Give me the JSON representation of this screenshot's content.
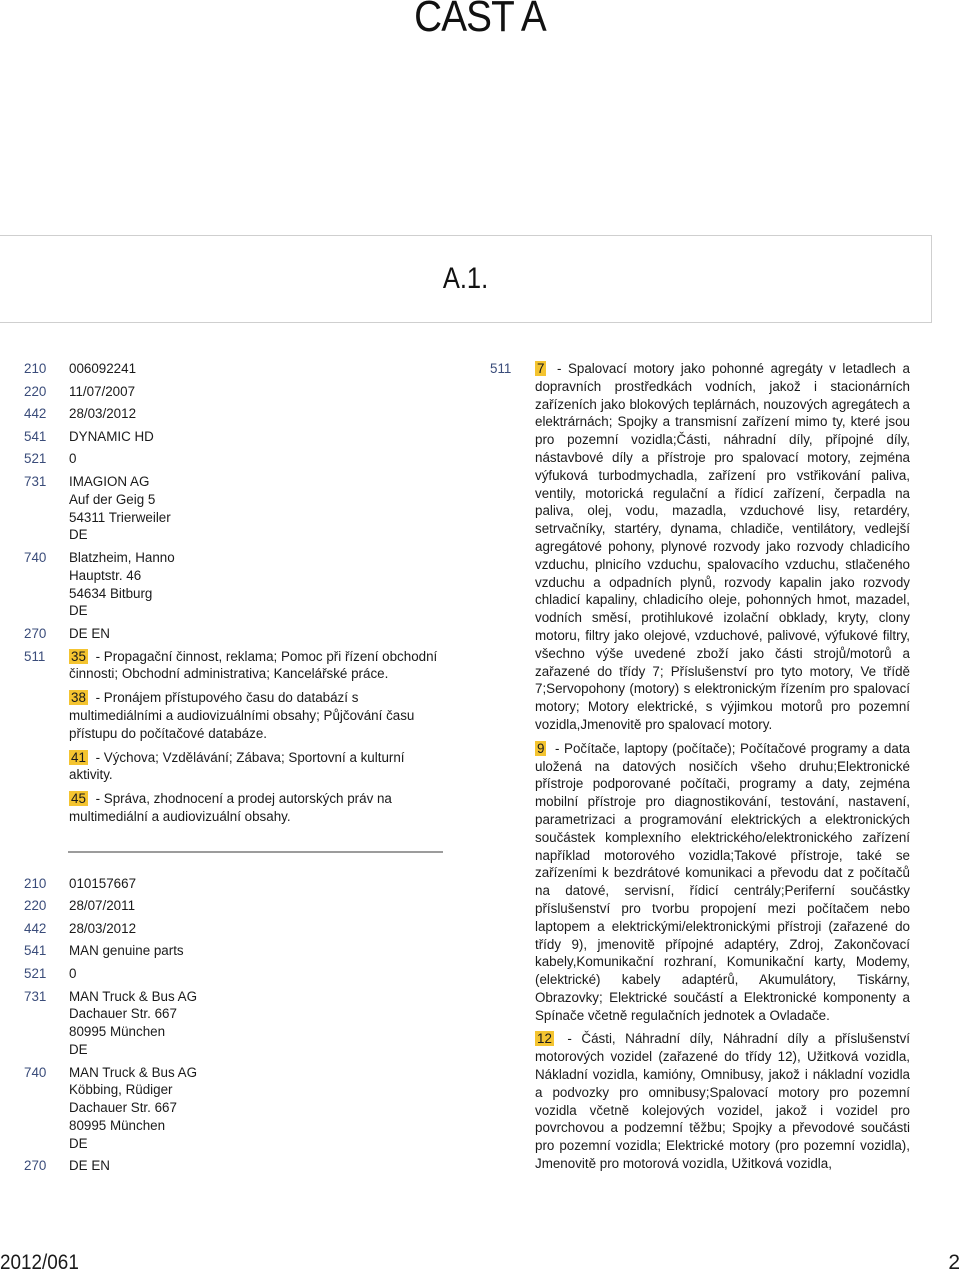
{
  "page": {
    "part_title": "ČÁST A",
    "section_title": "A.1.",
    "footer_issue": "2012/061",
    "footer_page": "2"
  },
  "records": [
    {
      "fields": [
        {
          "code": "210",
          "value": "006092241"
        },
        {
          "code": "220",
          "value": "11/07/2007"
        },
        {
          "code": "442",
          "value": "28/03/2012"
        },
        {
          "code": "541",
          "value": "DYNAMIC HD"
        },
        {
          "code": "521",
          "value": "0"
        },
        {
          "code": "731",
          "value": "IMAGION AG\nAuf der Geig 5\n54311 Trierweiler\nDE"
        },
        {
          "code": "740",
          "value": "Blatzheim, Hanno\nHauptstr. 46\n54634 Bitburg\nDE"
        },
        {
          "code": "270",
          "value": "DE EN"
        }
      ],
      "goods_code": "511",
      "goods": [
        {
          "class": "35",
          "text": " - Propagační činnost, reklama; Pomoc při řízení obchodní činnosti; Obchodní administrativa; Kancelářské práce."
        },
        {
          "class": "38",
          "text": " - Pronájem přístupového času do databází s multimediálními a audiovizuálními obsahy; Půjčování času přístupu do počítačové databáze."
        },
        {
          "class": "41",
          "text": " - Výchova; Vzdělávání; Zábava; Sportovní a kulturní aktivity."
        },
        {
          "class": "45",
          "text": " - Správa, zhodnocení a prodej autorských práv na multimediální a audiovizuální obsahy."
        }
      ]
    },
    {
      "fields": [
        {
          "code": "210",
          "value": "010157667"
        },
        {
          "code": "220",
          "value": "28/07/2011"
        },
        {
          "code": "442",
          "value": "28/03/2012"
        },
        {
          "code": "541",
          "value": "MAN genuine parts"
        },
        {
          "code": "521",
          "value": "0"
        },
        {
          "code": "731",
          "value": "MAN Truck & Bus AG\nDachauer Str. 667\n80995 München\nDE"
        },
        {
          "code": "740",
          "value": "MAN Truck & Bus AG\nKöbbing, Rüdiger\nDachauer Str. 667\n80995 München\nDE"
        },
        {
          "code": "270",
          "value": "DE EN"
        }
      ],
      "goods_code": "511",
      "goods": [
        {
          "class": "7",
          "text": " - Spalovací motory jako pohonné agregáty v letadlech a dopravních prostředkách vodních, jakož i stacionárních zařízeních jako blokových teplárnách, nouzových agregátech a elektrárnách; Spojky a transmisní zařízení mimo ty, které jsou pro pozemní vozidla;Části, náhradní díly, přípojné díly, nástavbové díly a přístroje pro spalovací motory, zejména výfuková turbodmychadla, zařízení pro vstřikování paliva, ventily, motorická regulační a řídicí zařízení, čerpadla na paliva, olej, vodu, mazadla, vzduchové lisy, retardéry, setrvačníky, startéry, dynama, chladiče, ventilátory, vedlejší agregátové pohony, plynové rozvody jako rozvody chladicího vzduchu, plnicího vzduchu, spalovacího vzduchu, stlačeného vzduchu a odpadních plynů, rozvody kapalin jako rozvody chladicí kapaliny, chladicího oleje, pohonných hmot, mazadel, vodních směsí, protihlukové izolační obklady, kryty, clony motoru, filtry jako olejové, vzduchové, palivové, výfukové filtry, všechno výše uvedené zboží jako části strojů/motorů a zařazené do třídy 7; Příslušenství pro tyto motory, Ve třídě 7;Servopohony (motory) s elektronickým řízením pro spalovací motory; Motory elektrické, s výjimkou motorů pro pozemní vozidla,Jmenovitě pro spalovací motory."
        },
        {
          "class": "9",
          "text": " - Počítače, laptopy (počítače); Počítačové programy a data uložená na datových nosičích všeho druhu;Elektronické přístroje podporované počítači, programy a daty, zejména mobilní přístroje pro diagnostikování, testování, nastavení, parametrizaci a programování elektrických a elektronických součástek komplexního elektrického/elektronického zařízení například motorového vozidla;Takové přístroje, také se zařízeními k bezdrátové komunikaci a převodu dat z počítačů na datové, servisní, řídicí centrály;Periferní součástky příslušenství pro tvorbu propojení mezi počítačem nebo laptopem a elektrickými/elektronickými přístroji (zařazené do třídy 9), jmenovitě přípojné adaptéry, Zdroj, Zakončovací kabely,Komunikační rozhraní, Komunikační karty, Modemy, (elektrické) kabely adaptérů, Akumulátory, Tiskárny, Obrazovky; Elektrické součástí a Elektronické komponenty a Spínače včetně regulačních jednotek a Ovladače."
        },
        {
          "class": "12",
          "text": " - Části, Náhradní díly, Náhradní díly a příslušenství motorových vozidel (zařazené do třídy 12), Užitková vozidla, Nákladní vozidla, kamióny, Omnibusy, jakož i nákladní vozidla a podvozky pro omnibusy;Spalovací motory pro pozemní vozidla včetně kolejových vozidel, jakož i vozidel pro povrchovou a podzemní těžbu; Spojky a převodové součásti pro pozemní vozidla; Elektrické motory (pro pozemní vozidla), Jmenovitě pro motorová vozidla, Užitková vozidla,"
        }
      ]
    }
  ]
}
